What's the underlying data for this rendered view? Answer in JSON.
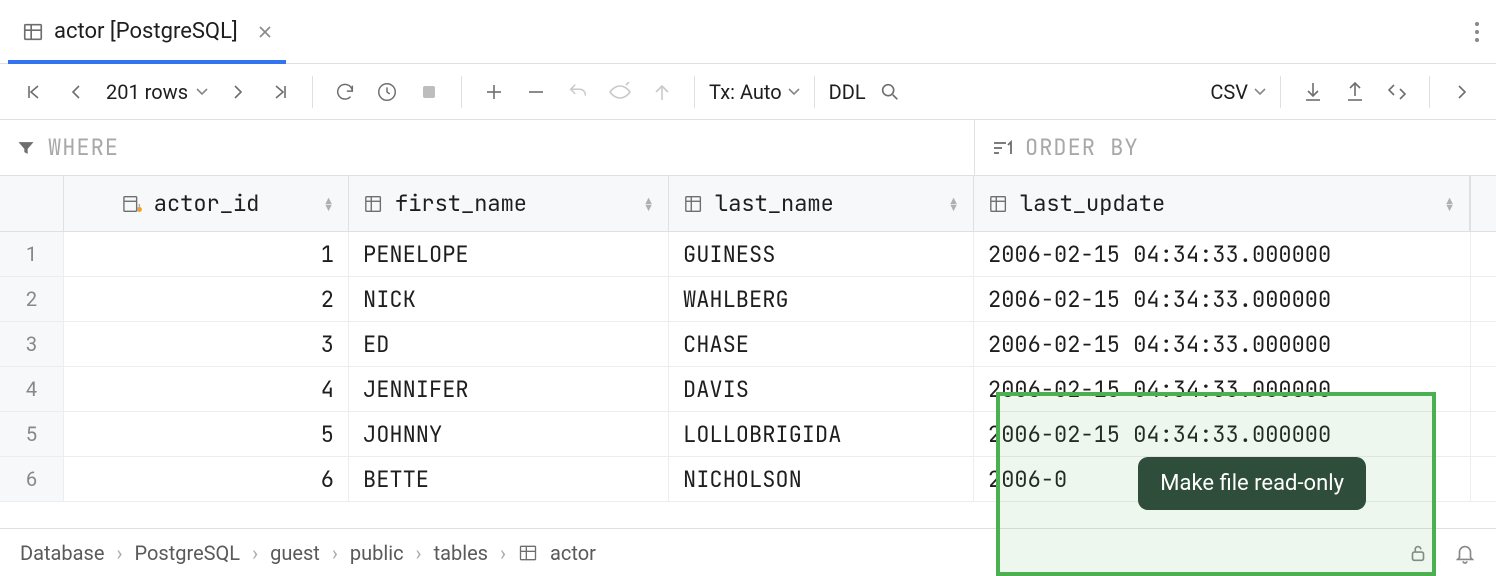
{
  "tab": {
    "title": "actor [PostgreSQL]"
  },
  "toolbar": {
    "rows_label": "201 rows",
    "tx_label": "Tx: Auto",
    "ddl_label": "DDL",
    "csv_label": "CSV"
  },
  "filters": {
    "where": "WHERE",
    "order_by": "ORDER BY"
  },
  "columns": [
    {
      "name": "actor_id"
    },
    {
      "name": "first_name"
    },
    {
      "name": "last_name"
    },
    {
      "name": "last_update"
    }
  ],
  "rows": [
    {
      "n": "1",
      "actor_id": "1",
      "first_name": "PENELOPE",
      "last_name": "GUINESS",
      "last_update": "2006-02-15 04:34:33.000000"
    },
    {
      "n": "2",
      "actor_id": "2",
      "first_name": "NICK",
      "last_name": "WAHLBERG",
      "last_update": "2006-02-15 04:34:33.000000"
    },
    {
      "n": "3",
      "actor_id": "3",
      "first_name": "ED",
      "last_name": "CHASE",
      "last_update": "2006-02-15 04:34:33.000000"
    },
    {
      "n": "4",
      "actor_id": "4",
      "first_name": "JENNIFER",
      "last_name": "DAVIS",
      "last_update": "2006-02-15 04:34:33.000000"
    },
    {
      "n": "5",
      "actor_id": "5",
      "first_name": "JOHNNY",
      "last_name": "LOLLOBRIGIDA",
      "last_update": "2006-02-15 04:34:33.000000"
    },
    {
      "n": "6",
      "actor_id": "6",
      "first_name": "BETTE",
      "last_name": "NICHOLSON",
      "last_update": "2006-0"
    }
  ],
  "breadcrumb": {
    "items": [
      "Database",
      "PostgreSQL",
      "guest",
      "public",
      "tables",
      "actor"
    ]
  },
  "tooltip": "Make file read-only"
}
